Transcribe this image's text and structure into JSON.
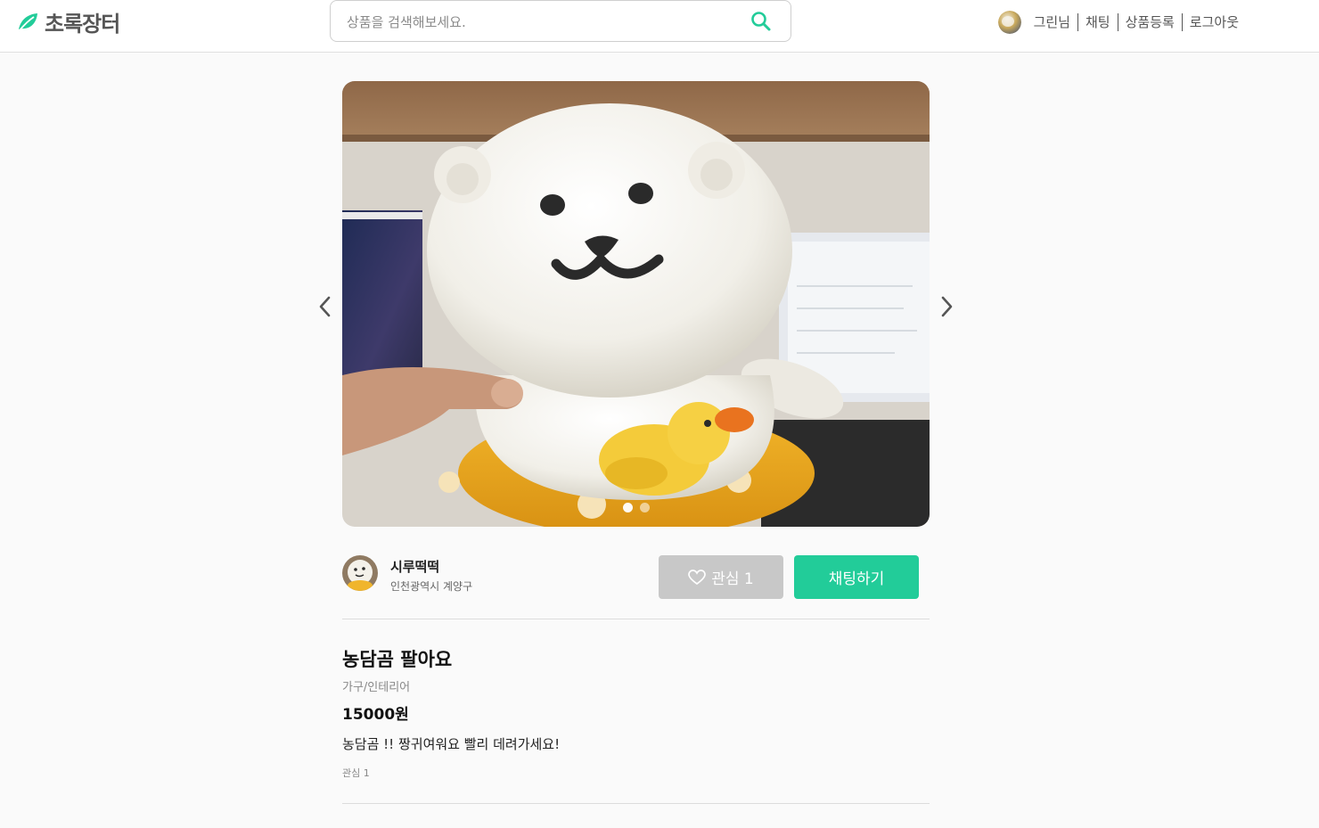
{
  "header": {
    "logo_text": "초록장터",
    "logo_icon": "leaf-icon",
    "search": {
      "placeholder": "상품을 검색해보세요.",
      "value": ""
    },
    "nav": {
      "user_name": "그린님",
      "chat_label": "채팅",
      "register_label": "상품등록",
      "logout_label": "로그아웃"
    }
  },
  "carousel": {
    "slide_count": 2,
    "active_index": 0
  },
  "seller": {
    "name": "시루떡떡",
    "location": "인천광역시 계양구"
  },
  "actions": {
    "like_label": "관심 1",
    "chat_label": "채팅하기"
  },
  "product": {
    "title": "농담곰 팔아요",
    "category": "가구/인테리어",
    "price": "15000원",
    "description": "농담곰 !! 짱귀여워요 빨리 데려가세요!",
    "likes_text": "관심 1"
  },
  "colors": {
    "accent": "#22cc99",
    "like_button": "#c8c8c8",
    "background": "#fafafa"
  }
}
